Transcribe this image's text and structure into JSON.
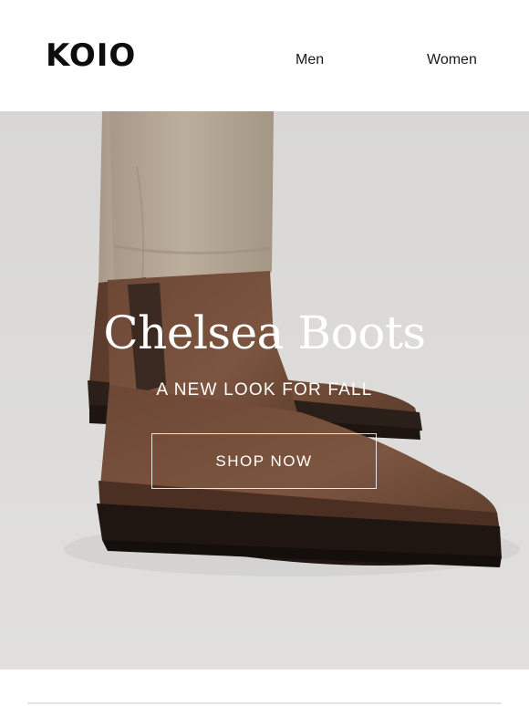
{
  "header": {
    "logo": "KOIO",
    "nav": [
      {
        "label": "Men"
      },
      {
        "label": "Women"
      }
    ]
  },
  "hero": {
    "title": "Chelsea Boots",
    "subtitle": "A NEW LOOK FOR FALL",
    "cta_label": "SHOP NOW",
    "image_icon": "boots-photo",
    "colors": {
      "background": "#dcdbd9",
      "pants": "#b6a692",
      "leather": "#6e4a36",
      "sole": "#2a1e18",
      "text": "#ffffff"
    }
  }
}
